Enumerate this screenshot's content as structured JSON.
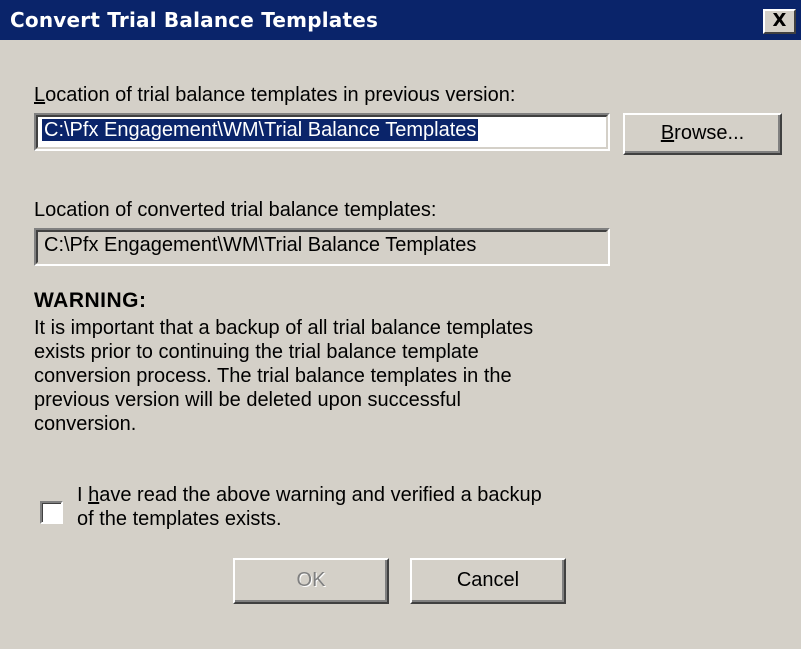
{
  "window": {
    "title": "Convert Trial Balance Templates",
    "close_glyph": "X"
  },
  "source": {
    "label_first": "L",
    "label_rest": "ocation of trial balance templates in previous version:",
    "value": "C:\\Pfx Engagement\\WM\\Trial Balance Templates"
  },
  "browse_button": {
    "label_first": "B",
    "label_rest": "rowse..."
  },
  "destination": {
    "label": "Location of converted trial balance templates:",
    "value": "C:\\Pfx Engagement\\WM\\Trial Balance Templates"
  },
  "warning": {
    "heading": "WARNING:",
    "line1": "It is important that a backup of all trial balance templates",
    "line2": "exists prior to continuing the trial balance template",
    "line3": "conversion process. The trial balance templates in the",
    "line4": "previous version will be deleted upon successful",
    "line5": "conversion."
  },
  "confirm": {
    "checked": false,
    "text_before": "I ",
    "text_mnemonic": "h",
    "text_line1_rest": "ave read the above warning and verified a backup",
    "text_line2": "of the templates exists."
  },
  "buttons": {
    "ok": "OK",
    "cancel": "Cancel"
  },
  "colors": {
    "titlebar": "#0a246a",
    "face": "#d4d0c8",
    "selection": "#0a246a"
  }
}
